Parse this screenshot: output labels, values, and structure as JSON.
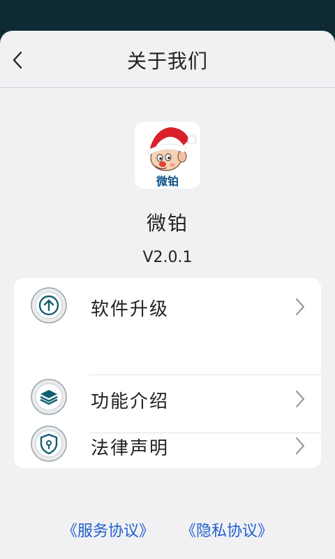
{
  "header": {
    "title": "关于我们",
    "back_icon": "chevron-left-icon"
  },
  "app": {
    "name": "微铂",
    "version": "V2.0.1",
    "logo_text": "微铂"
  },
  "menu": {
    "items": [
      {
        "label": "软件升级",
        "icon": "upgrade-arrow-icon"
      },
      {
        "label": "功能介绍",
        "icon": "layers-icon"
      },
      {
        "label": "法律声明",
        "icon": "shield-lock-icon"
      }
    ]
  },
  "footer": {
    "service_agreement": "《服务协议》",
    "privacy_agreement": "《隐私协议》"
  },
  "colors": {
    "accent_link": "#1f5fcf",
    "icon_teal": "#0f5f70",
    "background": "#f1f1f3"
  }
}
